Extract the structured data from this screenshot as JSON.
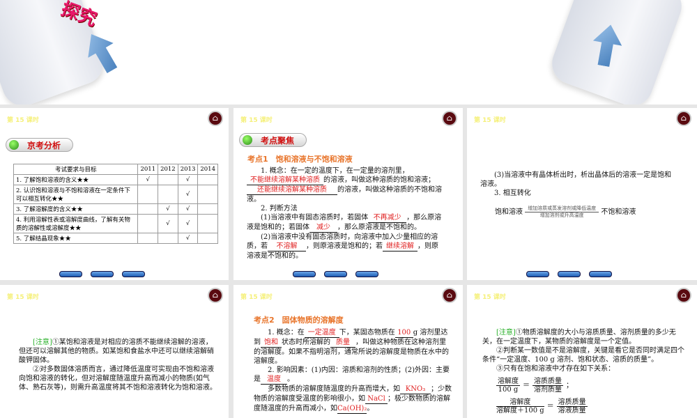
{
  "hero": {
    "tag": "探究"
  },
  "lesson": "第 15 课时",
  "s1": {
    "section": "京考分析",
    "headers": [
      "考试要求与目标",
      "2011",
      "2012",
      "2013",
      "2014"
    ],
    "rows": [
      [
        "1. 了解饱和溶液的含义★★",
        "√",
        "",
        "√",
        ""
      ],
      [
        "2. 认识饱和溶液与不饱和溶液在一定条件下可以相互转化★★",
        "",
        "",
        "√",
        ""
      ],
      [
        "3. 了解溶解度的含义★★",
        "",
        "√",
        "√",
        ""
      ],
      [
        "4. 利用溶解性表或溶解度曲线，了解有关物质的溶解性或溶解度★★",
        "",
        "√",
        "√",
        ""
      ],
      [
        "5. 了解结晶现象★★",
        "",
        "",
        "√",
        ""
      ]
    ]
  },
  "s2": {
    "section": "考点聚焦",
    "heading": "考点1　饱和溶液与不饱和溶液",
    "p1a": "1. 概念：在一定的温度下，在一定量的溶剂里，",
    "b1": "不能继续溶解某种溶质",
    "p1b": "的溶液，叫做这种溶质的饱和溶液；",
    "b2": "还能继续溶解某种溶质",
    "p1c": "的溶液，叫做这种溶质的不饱和溶液。",
    "p2": "2. 判断方法",
    "p3a": "(1)当溶液中有固态溶质时，若固体",
    "b3": "不再减少",
    "p3b": "，那么原溶液是饱和的；若固体",
    "b4": "减少",
    "p3c": "，那么原溶液是不饱和的。",
    "p4a": "(2)当溶液中没有固态溶质时，向溶液中加入少量相应的溶质，若",
    "b5": "不溶解",
    "p4b": "，则原溶液是饱和的；若",
    "b6": "继续溶解",
    "p4c": "，则原溶液是不饱和的。"
  },
  "s3": {
    "p1": "(3)当溶液中有晶体析出时，析出晶体后的溶液一定是饱和溶液。",
    "p2": "3. 相互转化",
    "left": "饱和溶液",
    "top": "增加溶质或蒸发溶剂或降低温度",
    "bottom": "增加溶剂或升高温度",
    "right": "不饱和溶液"
  },
  "s4": {
    "note": "[注意]",
    "p1": "①某饱和溶液是对相应的溶质不能继续溶解的溶液，但还可以溶解其他的物质。如某饱和食盐水中还可以继续溶解硝酸钾固体。",
    "p2": "②对多数固体溶质而言，通过降低温度可实现由不饱和溶液向饱和溶液的转化，但对溶解度随温度升高而减小的物质(如气体、熟石灰等)，则需升高温度将其不饱和溶液转化为饱和溶液。"
  },
  "s5": {
    "heading": "考点2　固体物质的溶解度",
    "a1": "1. 概念：在",
    "b1": "一定温度",
    "a2": "下，某固态物质在",
    "b2": "100",
    "a3": "g 溶剂里达到",
    "b3": "饱和",
    "a4": "状态时所溶解的",
    "b4": "质量",
    "a5": "，叫做这种物质在这种溶剂里的溶解度。如果不指明溶剂，通常所说的溶解度是物质在水中的溶解度。",
    "c1": "2. 影响因素：(1)内因：溶质和溶剂的性质；(2)外因：主要是",
    "b5": "温度",
    "c2": "。",
    "d1": "多数物质的溶解度随温度的升高而增大，如",
    "b6": "KNO₃",
    "d2": "；少数物质的溶解度受温度的影响很小，如",
    "b7": "NaCl",
    "d3": "；极少数物质的溶解度随温度的升高而减小，如",
    "b8": "Ca(OH)₂",
    "d4": "。"
  },
  "s6": {
    "note": "[注意]",
    "p1": "①物质溶解度的大小与溶质质量、溶剂质量的多少无关，在一定温度下，某物质的溶解度是一个定值。",
    "p2": "②判断某一数值是不是溶解度，关键是看它是否同时满足四个条件“一定温度、100 g 溶剂、饱和状态、溶质的质量”。",
    "p3": "③只有在饱和溶液中才存在如下关系：",
    "f1n": "溶解度",
    "f1d": "100 g",
    "f1rn": "溶质质量",
    "f1rd": "溶剂质量",
    "f2n": "溶解度",
    "f2d": "溶解度＋100 g",
    "f2rn": "溶质质量",
    "f2rd": "溶液质量"
  }
}
